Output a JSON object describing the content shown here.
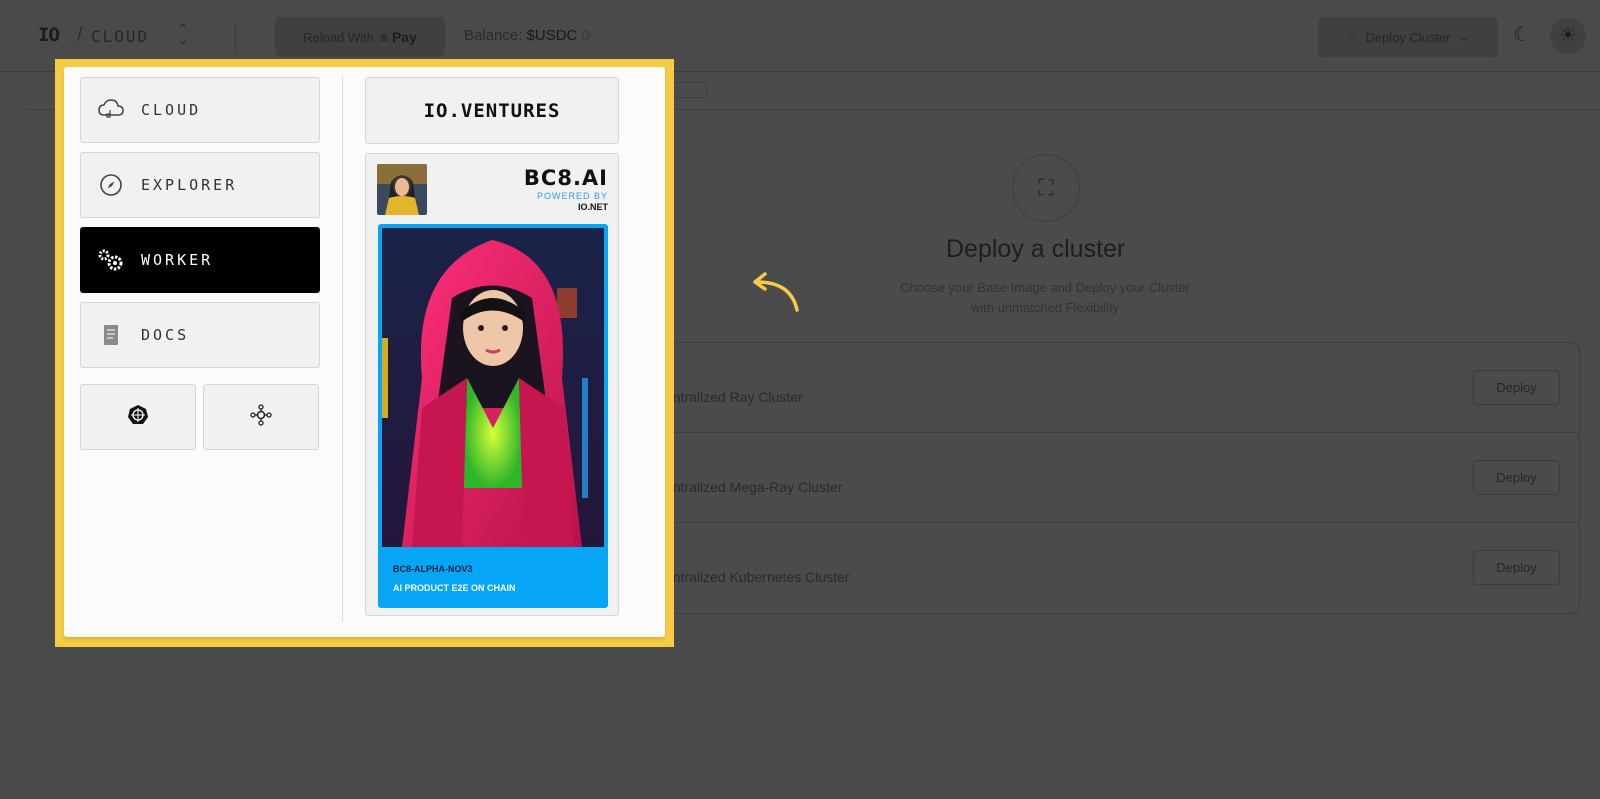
{
  "header": {
    "logo": "IO",
    "separator": "/",
    "brand": "CLOUD",
    "reload_label": "Reload With",
    "pay_label": "Pay",
    "balance_label": "Balance:",
    "balance_currency": "$USDC",
    "balance_value": "0",
    "deploy_button_label": "Deploy Cluster"
  },
  "main": {
    "title": "Deploy a cluster",
    "subtitle": "Choose your Base Image and Deploy your Cluster with unmatched Flexibility",
    "clusters": [
      {
        "name": "entralized Ray Cluster",
        "button": "Deploy"
      },
      {
        "name": "entralized Mega-Ray Cluster",
        "button": "Deploy"
      },
      {
        "name": "entralized Kubernetes Cluster",
        "button": "Deploy"
      }
    ]
  },
  "popup": {
    "menu": [
      {
        "label": "CLOUD",
        "icon": "cloud-icon"
      },
      {
        "label": "EXPLORER",
        "icon": "compass-icon"
      },
      {
        "label": "WORKER",
        "icon": "gears-icon",
        "active": true
      },
      {
        "label": "DOCS",
        "icon": "document-icon"
      }
    ],
    "small_icons": [
      "kubernetes-icon",
      "network-nodes-icon"
    ],
    "ventures_label": "IO.VENTURES",
    "promo": {
      "title": "BC8.AI",
      "powered_by": "POWERED BY",
      "powered_brand": "IO.NET",
      "caption_1": "BC8-ALPHA-NOV3",
      "caption_2": "AI PRODUCT E2E ON CHAIN"
    }
  },
  "colors": {
    "highlight_frame": "#f7cc45",
    "promo_blue": "#06a6f4",
    "overlay": "#4b4b4b"
  }
}
